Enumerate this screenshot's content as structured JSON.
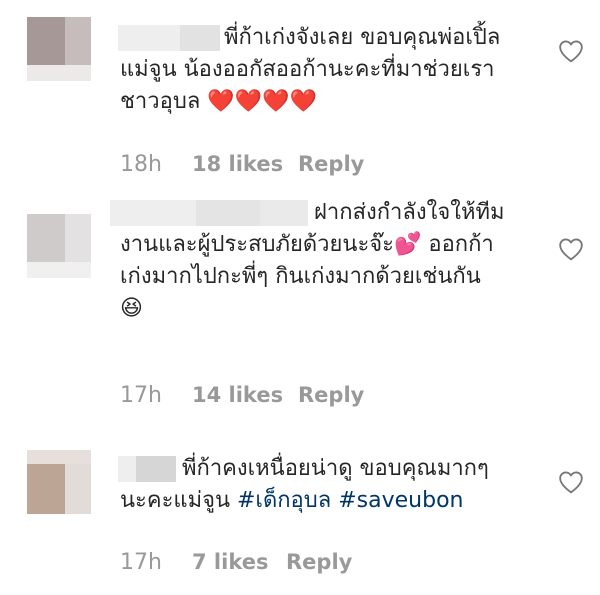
{
  "comments": [
    {
      "lines": [
        "พี่ก้าเก่งจังเลย ขอบคุณพ่อเปิ้ล",
        "แม่จูน น้องออกัสออก้านะคะที่มาช่วยเรา",
        "ชาวอุบล ❤️❤️❤️❤️"
      ],
      "time": "18h",
      "likes": "18 likes",
      "reply": "Reply",
      "like_icon": "heart-outline-icon"
    },
    {
      "lines": [
        "ฝากส่งกำลังใจให้ทีม",
        "งานและผู้ประสบภัยด้วยนะจ๊ะ💕 ออกก้า",
        "เก่งมากไปกะพี่ๆ กินเก่งมากด้วยเช่นกัน",
        "😆"
      ],
      "time": "17h",
      "likes": "14 likes",
      "reply": "Reply",
      "like_icon": "heart-outline-icon"
    },
    {
      "lines": [
        "พี่ก้าคงเหนื่อยน่าดู ขอบคุณมากๆ",
        "นะคะแม่จูน"
      ],
      "hashtags": [
        "#เด็กอุบล",
        "#saveubon"
      ],
      "time": "17h",
      "likes": "7 likes",
      "reply": "Reply",
      "like_icon": "heart-outline-icon"
    }
  ],
  "colors": {
    "text": "#262626",
    "meta": "#999999",
    "hashtag": "#003569",
    "blur_light": "#eeeeee",
    "blur_mid": "#e4e4e4"
  }
}
